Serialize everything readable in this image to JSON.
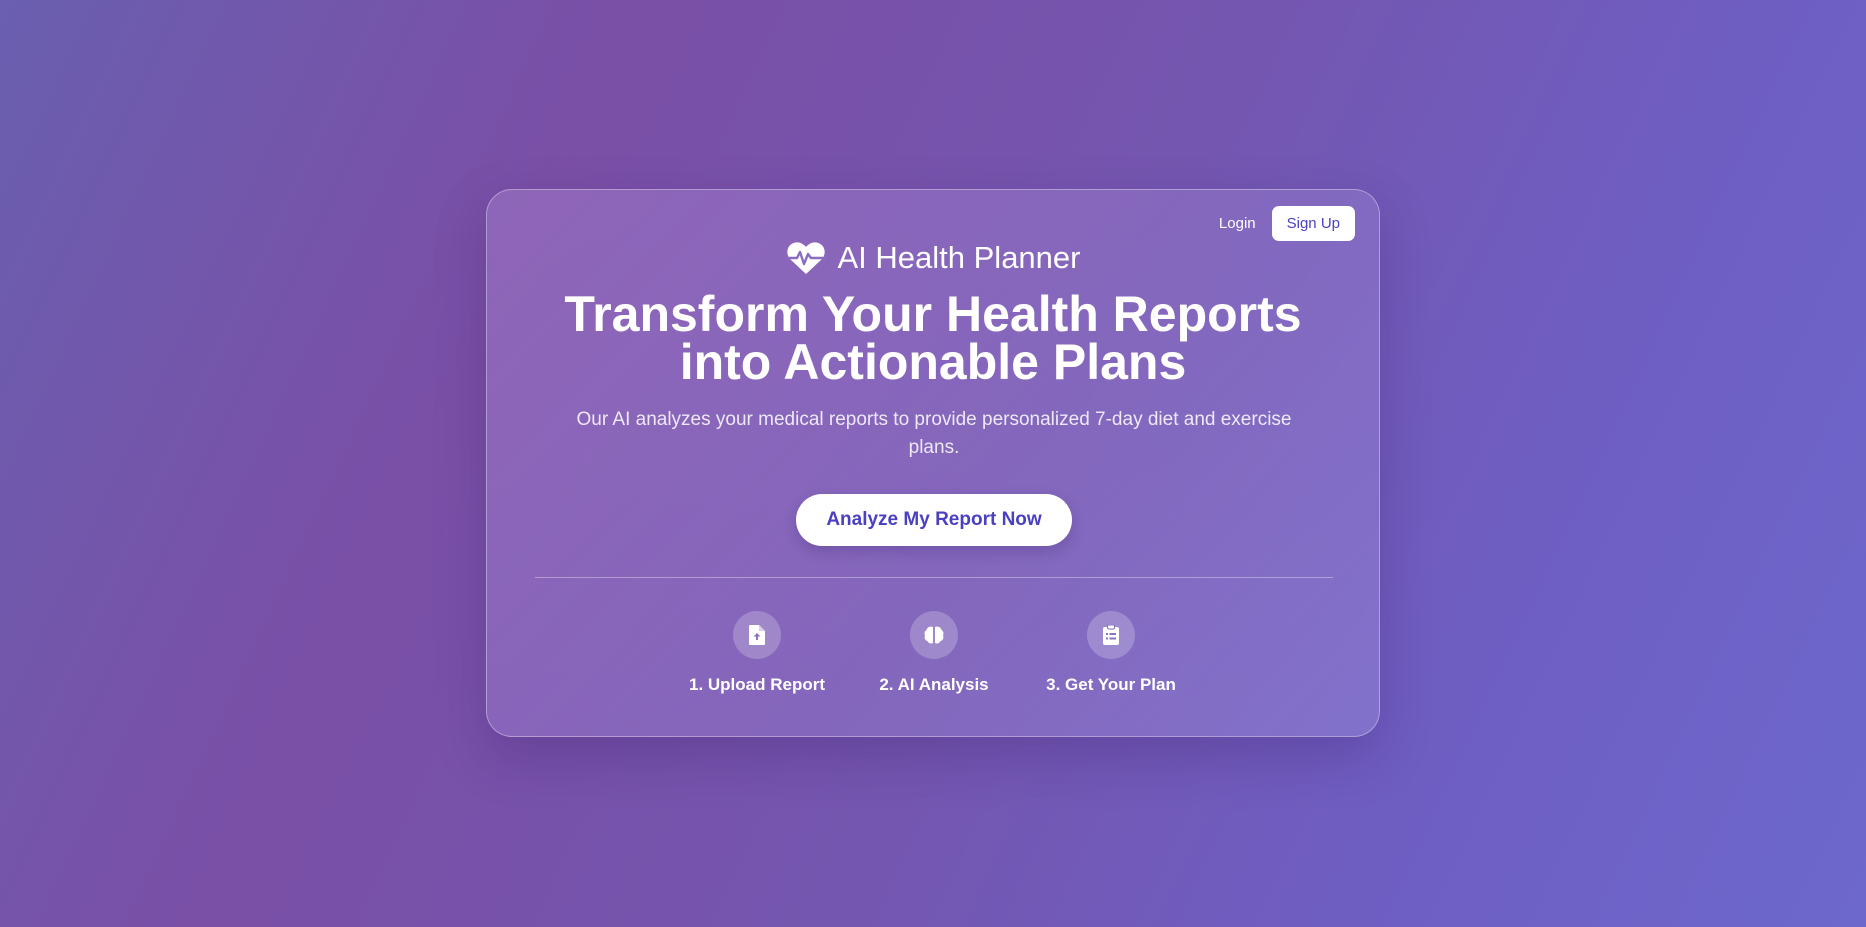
{
  "header": {
    "login_label": "Login",
    "signup_label": "Sign Up"
  },
  "brand": {
    "name": "AI Health Planner",
    "icon": "heartbeat-icon"
  },
  "hero": {
    "headline_line1": "Transform Your Health Reports",
    "headline_line2": "into Actionable Plans",
    "subtitle": "Our AI analyzes your medical reports to provide personalized 7-day diet and exercise plans.",
    "cta_label": "Analyze My Report Now"
  },
  "steps": [
    {
      "label": "1. Upload Report",
      "icon": "file-upload-icon"
    },
    {
      "label": "2. AI Analysis",
      "icon": "brain-icon"
    },
    {
      "label": "3. Get Your Plan",
      "icon": "clipboard-list-icon"
    }
  ],
  "colors": {
    "accent": "#4b3fc2",
    "background_start": "#6a5fb0",
    "background_end": "#6d68cc",
    "text": "#ffffff"
  }
}
